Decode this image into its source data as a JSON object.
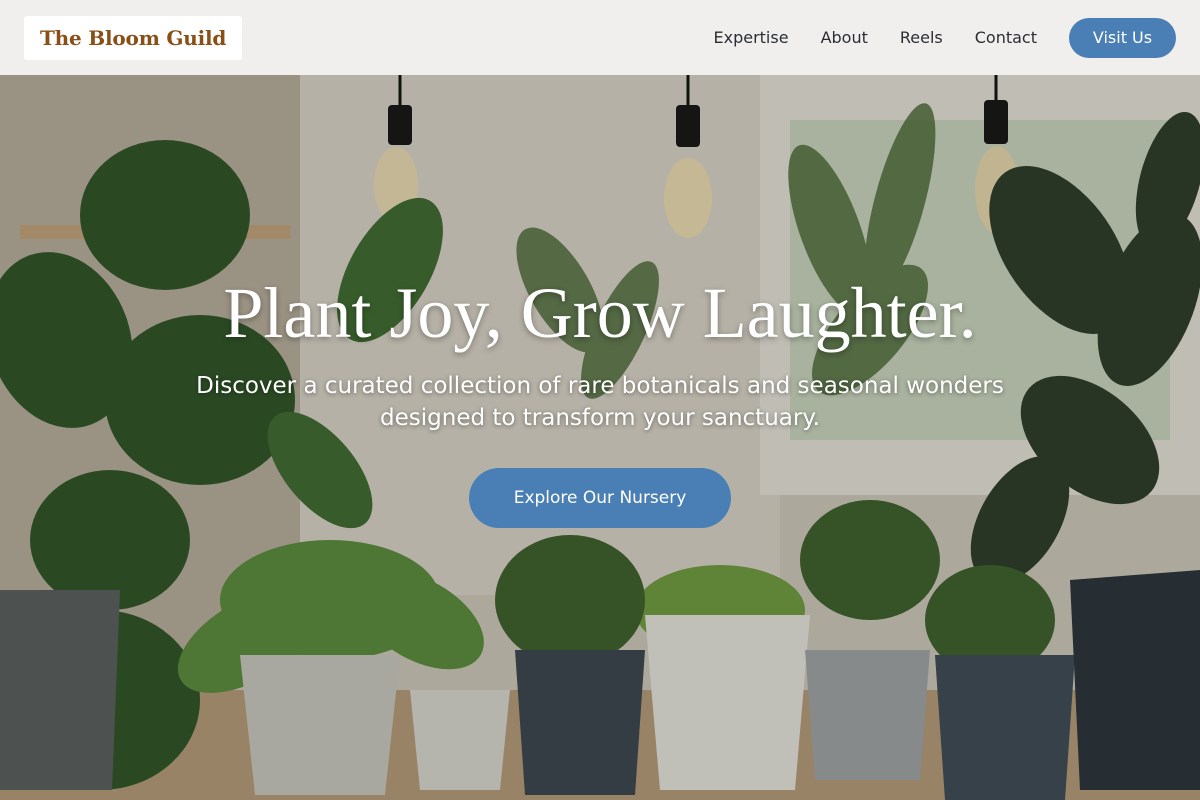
{
  "brand": {
    "name": "The Bloom Guild"
  },
  "nav": {
    "links": [
      {
        "label": "Expertise"
      },
      {
        "label": "About"
      },
      {
        "label": "Reels"
      },
      {
        "label": "Contact"
      }
    ],
    "cta_label": "Visit Us"
  },
  "hero": {
    "title": "Plant Joy, Grow Laughter.",
    "subtitle": "Discover a curated collection of rare botanicals and seasonal wonders designed to transform your sanctuary.",
    "cta_label": "Explore Our Nursery"
  },
  "colors": {
    "accent": "#4a7fb5",
    "logo_text": "#8a4f17",
    "nav_background": "#f4f3f1"
  }
}
